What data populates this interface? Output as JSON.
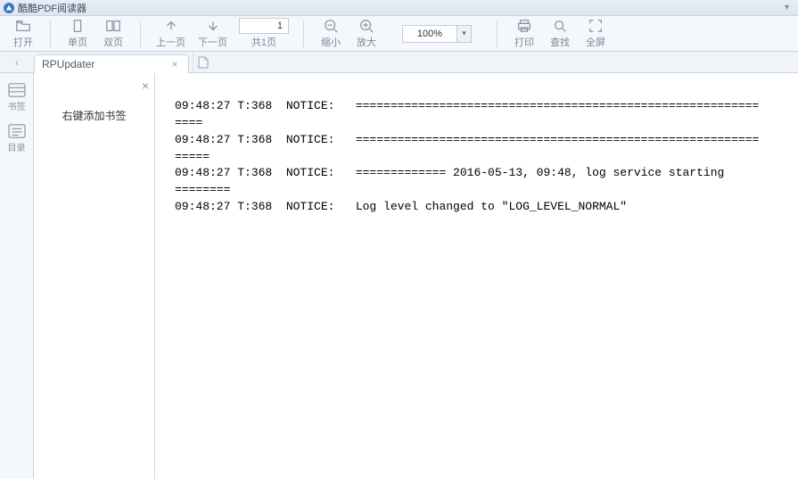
{
  "app": {
    "title": "酷酷PDF阅读器"
  },
  "toolbar": {
    "open": "打开",
    "single_page": "单页",
    "double_page": "双页",
    "prev_page": "上一页",
    "next_page": "下一页",
    "page_total": "共1页",
    "page_input": "1",
    "zoom_out": "缩小",
    "zoom_in": "放大",
    "zoom_value": "100%",
    "print": "打印",
    "find": "查找",
    "fullscreen": "全屏"
  },
  "tabs": {
    "items": [
      {
        "label": "RPUpdater"
      }
    ]
  },
  "side_rail": {
    "bookmarks": "书签",
    "outline": "目录"
  },
  "side_panel": {
    "bookmark_hint": "右键添加书签"
  },
  "document": {
    "lines": [
      "09:48:27 T:368  NOTICE:   ==========================================================",
      "====",
      "09:48:27 T:368  NOTICE:   ==========================================================",
      "=====",
      "09:48:27 T:368  NOTICE:   ============= 2016-05-13, 09:48, log service starting ",
      "========",
      "09:48:27 T:368  NOTICE:   Log level changed to \"LOG_LEVEL_NORMAL\""
    ]
  }
}
